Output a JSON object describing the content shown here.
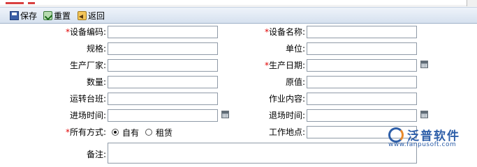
{
  "toolbar": {
    "save_label": "保存",
    "reset_label": "重置",
    "back_label": "返回"
  },
  "form": {
    "device_code": {
      "required": "*",
      "label": "设备编码:",
      "value": ""
    },
    "device_name": {
      "required": "*",
      "label": "设备名称:",
      "value": ""
    },
    "spec": {
      "label": "规格:",
      "value": ""
    },
    "unit": {
      "label": "单位:",
      "value": ""
    },
    "manufacturer": {
      "label": "生产厂家:",
      "value": ""
    },
    "production_date": {
      "required": "*",
      "label": "生产日期:",
      "value": ""
    },
    "quantity": {
      "label": "数量:",
      "value": ""
    },
    "original_value": {
      "label": "原值:",
      "value": ""
    },
    "operating_shifts": {
      "label": "运转台班:",
      "value": ""
    },
    "work_content": {
      "label": "作业内容:",
      "value": ""
    },
    "entry_time": {
      "label": "进场时间:",
      "value": ""
    },
    "exit_time": {
      "label": "退场时间:",
      "value": ""
    },
    "ownership": {
      "required": "*",
      "label": "所有方式:",
      "options": [
        "自有",
        "租赁"
      ],
      "selected": "自有"
    },
    "work_location": {
      "label": "工作地点:",
      "value": ""
    },
    "remarks": {
      "label": "备注:",
      "value": ""
    }
  },
  "logo": {
    "name": "泛普软件",
    "url": "www.fanpusoft.com",
    "colors": {
      "primary": "#2d5ea8",
      "accent": "#e98a2b"
    }
  }
}
